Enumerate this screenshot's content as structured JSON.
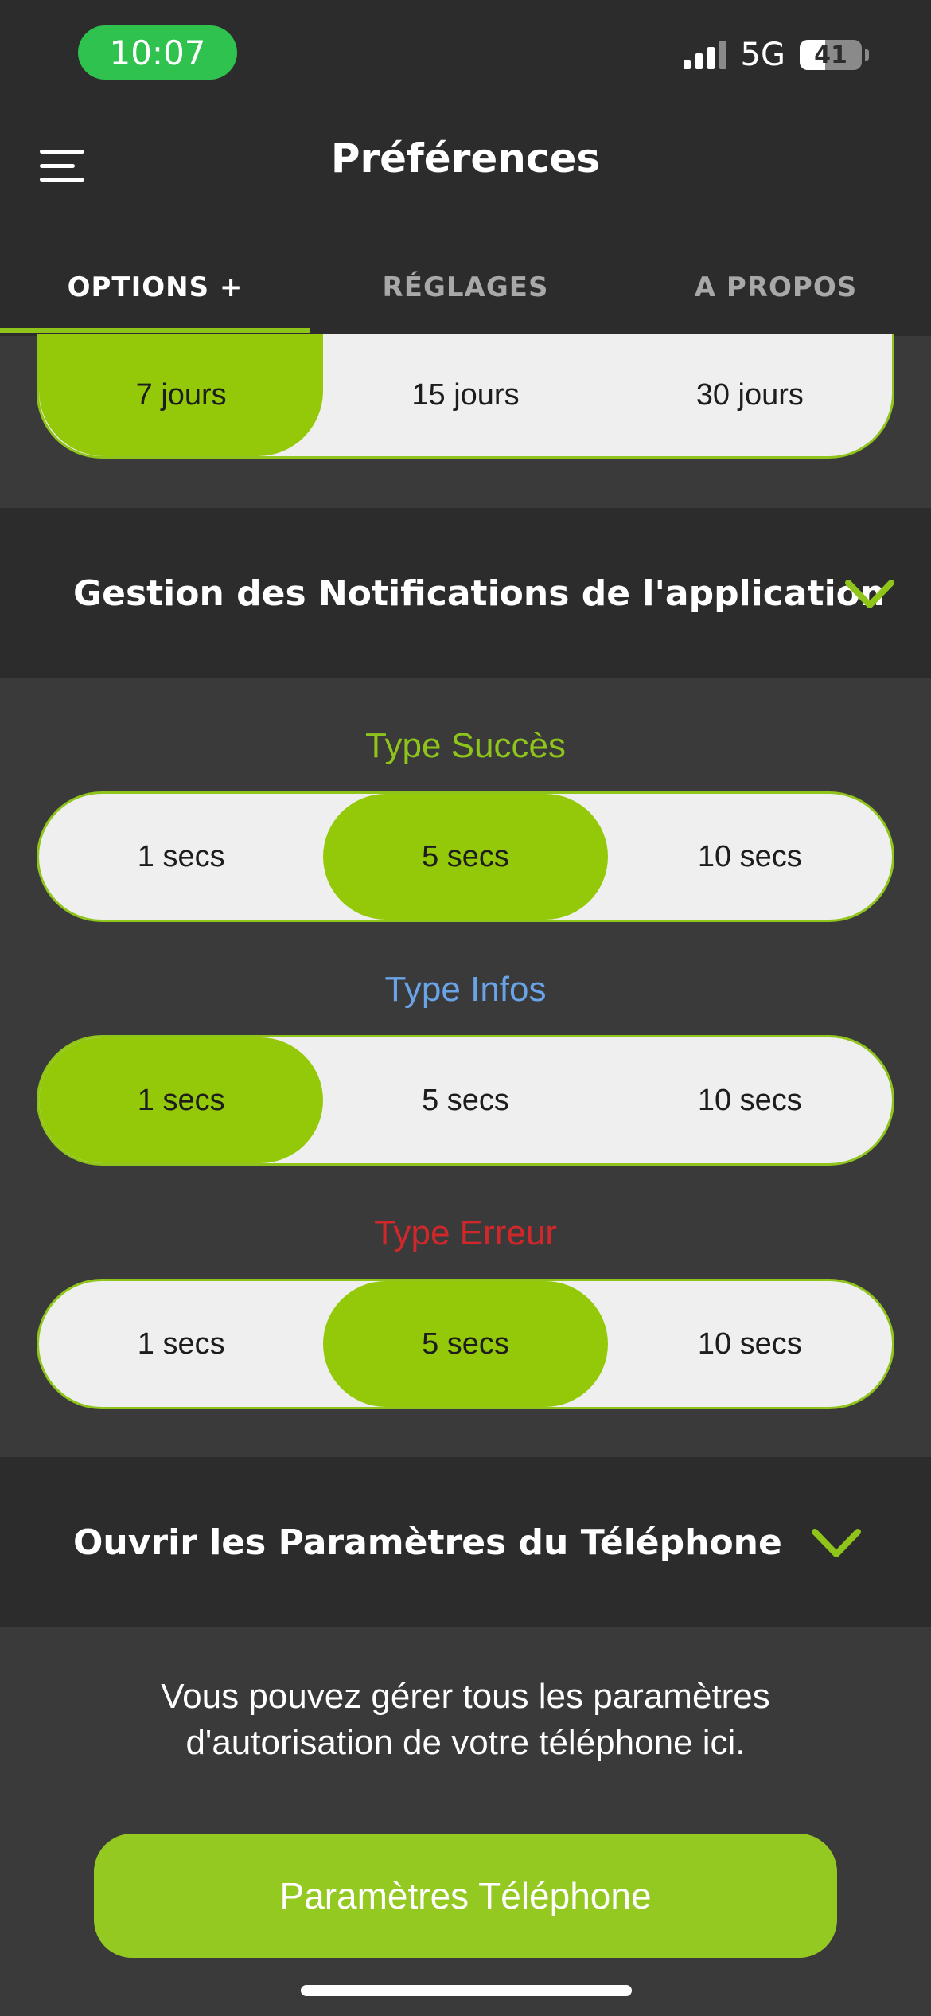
{
  "status_bar": {
    "time": "10:07",
    "network": "5G",
    "battery": "41",
    "battery_level": 0.41
  },
  "header": {
    "title": "Préférences"
  },
  "tabs": [
    {
      "label": "OPTIONS +",
      "active": true
    },
    {
      "label": "RÉGLAGES",
      "active": false
    },
    {
      "label": "A PROPOS",
      "active": false
    }
  ],
  "retention": {
    "options": [
      "7 jours",
      "15 jours",
      "30 jours"
    ],
    "selected": "7 jours"
  },
  "notifications_section": {
    "title": "Gestion des Notifications de l'application",
    "success": {
      "label": "Type Succès",
      "color": "#8fc41a",
      "options": [
        "1 secs",
        "5 secs",
        "10 secs"
      ],
      "selected": "5 secs"
    },
    "info": {
      "label": "Type Infos",
      "color": "#6aa4e8",
      "options": [
        "1 secs",
        "5 secs",
        "10 secs"
      ],
      "selected": "1 secs"
    },
    "error": {
      "label": "Type Erreur",
      "color": "#d0282a",
      "options": [
        "1 secs",
        "5 secs",
        "10 secs"
      ],
      "selected": "5 secs"
    }
  },
  "phone_settings_section": {
    "title": "Ouvrir les Paramètres du Téléphone",
    "description": "Vous pouvez gérer tous les paramètres d'autorisation de votre téléphone ici.",
    "button_label": "Paramètres Téléphone"
  },
  "colors": {
    "accent": "#94c90a",
    "background": "#3a3a3a",
    "header_background": "#2c2c2c"
  }
}
